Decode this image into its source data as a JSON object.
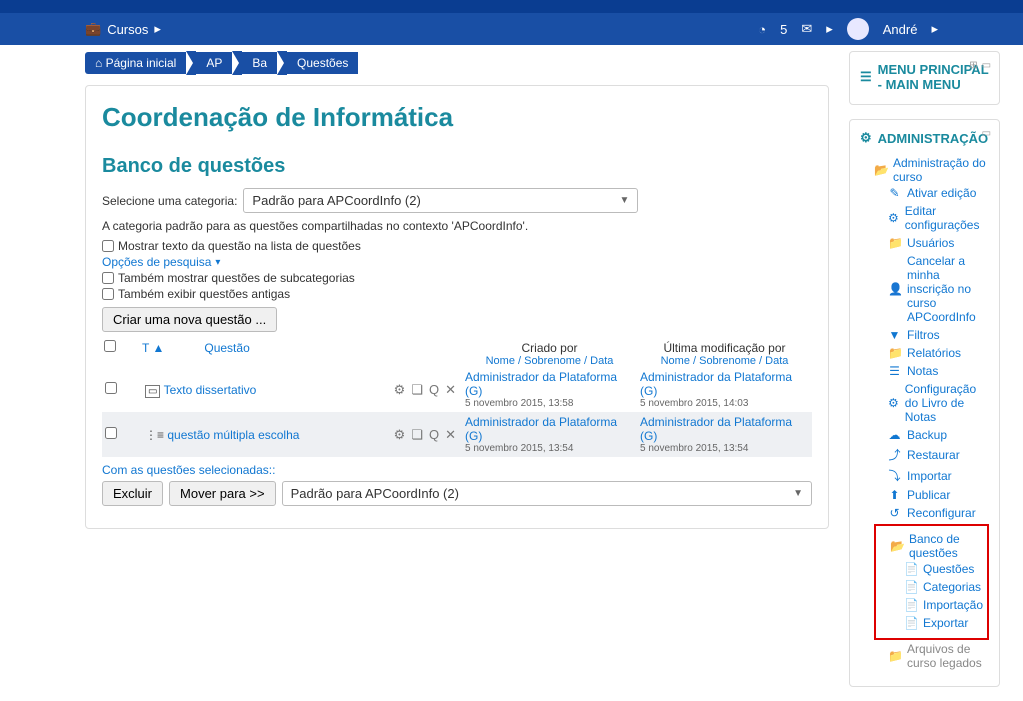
{
  "nav": {
    "courses": "Cursos",
    "msg_count": "5",
    "user": "André"
  },
  "breadcrumb": {
    "home": "Página inicial",
    "b1": "AP",
    "b2": "Ba",
    "b3": "Questões"
  },
  "page": {
    "title": "Coordenação de Informática",
    "bank_heading": "Banco de questões",
    "select_cat_label": "Selecione uma categoria:",
    "select_cat_value": "Padrão para APCoordInfo (2)",
    "cat_desc": "A categoria padrão para as questões compartilhadas no contexto 'APCoordInfo'.",
    "show_text": "Mostrar texto da questão na lista de questões",
    "search_opts": "Opções de pesquisa",
    "also_subcat": "Também mostrar questões de subcategorias",
    "also_old": "Também exibir questões antigas",
    "new_question_btn": "Criar uma nova questão ...",
    "col_type": "T",
    "col_question": "Questão",
    "col_created": "Criado por",
    "col_modified": "Última modificação por",
    "col_sub": "Nome / Sobrenome / Data",
    "rows": [
      {
        "icon": "essay-icon",
        "name": "Texto dissertativo",
        "created_by": "Administrador da Plataforma (G)",
        "created_at": "5 novembro 2015, 13:58",
        "modified_by": "Administrador da Plataforma (G)",
        "modified_at": "5 novembro 2015, 14:03"
      },
      {
        "icon": "multichoice-icon",
        "name": "questão múltipla escolha",
        "created_by": "Administrador da Plataforma (G)",
        "created_at": "5 novembro 2015, 13:54",
        "modified_by": "Administrador da Plataforma (G)",
        "modified_at": "5 novembro 2015, 13:54"
      }
    ],
    "with_selected": "Com as questões selecionadas::",
    "delete_btn": "Excluir",
    "move_btn": "Mover para >>",
    "move_target": "Padrão para APCoordInfo (2)"
  },
  "blocks": {
    "menu_title": "MENU PRINCIPAL - MAIN MENU",
    "admin_title": "ADMINISTRAÇÃO",
    "admin_root": "Administração do curso",
    "items": {
      "edit_on": "Ativar edição",
      "edit_cfg": "Editar configurações",
      "users": "Usuários",
      "unenrol": "Cancelar a minha inscrição no curso APCoordInfo",
      "filters": "Filtros",
      "reports": "Relatórios",
      "grades": "Notas",
      "gradebook": "Configuração do Livro de Notas",
      "backup": "Backup",
      "restore": "Restaurar",
      "import": "Importar",
      "publish": "Publicar",
      "reset": "Reconfigurar",
      "qbank": "Banco de questões",
      "q_questions": "Questões",
      "q_categories": "Categorias",
      "q_import": "Importação",
      "q_export": "Exportar",
      "legacy": "Arquivos de curso legados"
    }
  }
}
